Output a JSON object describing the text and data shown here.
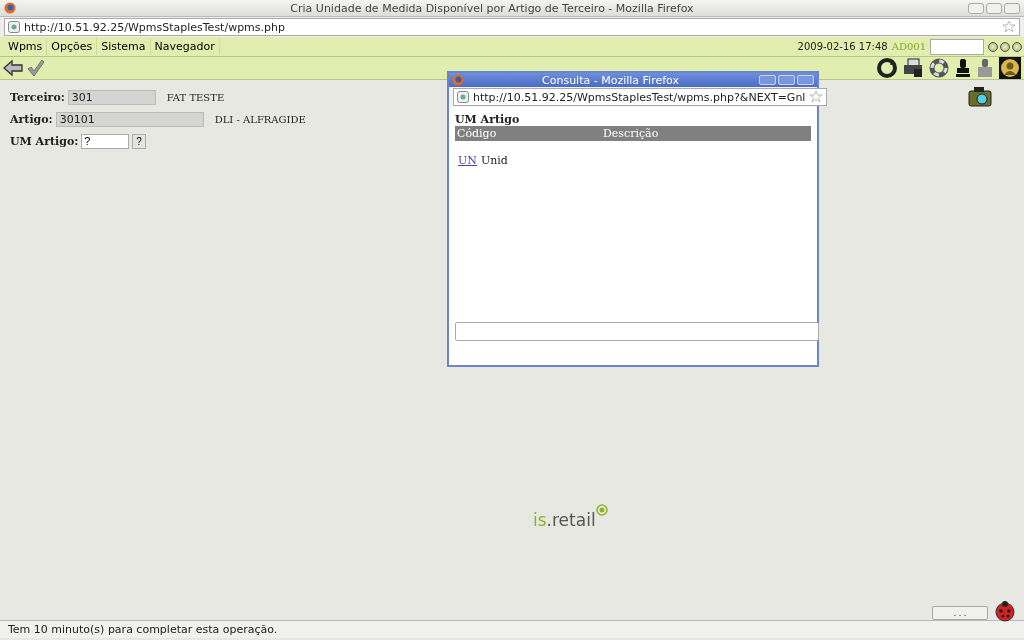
{
  "window": {
    "title": "Cria Unidade de Medida Disponível por Artigo de Terceiro - Mozilla Firefox",
    "url": "http://10.51.92.25/WpmsStaplesTest/wpms.php"
  },
  "menu": [
    "Wpms",
    "Opções",
    "Sistema",
    "Navegador"
  ],
  "header": {
    "datetime": "2009-02-16 17:48",
    "user": "AD001"
  },
  "form": [
    {
      "kind": "readonly",
      "label": "Terceiro:",
      "value": "301",
      "description": "FAT TESTE",
      "wide": false
    },
    {
      "kind": "readonly",
      "label": "Artigo:",
      "value": "30101",
      "description": "DLI - ALFRAGIDE",
      "wide": true
    },
    {
      "kind": "lookup",
      "label": "UM Artigo:",
      "value": "?",
      "button": "?"
    }
  ],
  "popup": {
    "title": "Consulta - Mozilla Firefox",
    "url": "http://10.51.92.25/WpmsStaplesTest/wpms.php?&NEXT=Gnl",
    "heading": "UM Artigo",
    "columns": [
      "Código",
      "Descrição"
    ],
    "rows": [
      {
        "code": "UN",
        "description": "Unid"
      }
    ]
  },
  "logo": {
    "text_1": "is",
    "text_2": ".retail"
  },
  "more_button": ". . .",
  "status_bar": "Tem 10 minuto(s) para completar esta operação."
}
